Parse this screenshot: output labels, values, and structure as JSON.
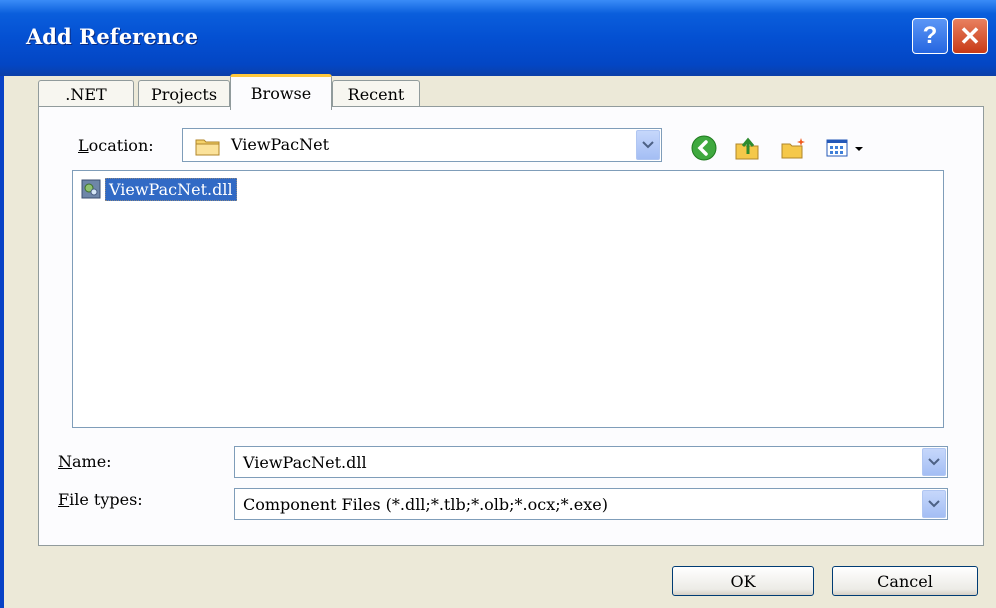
{
  "dialog": {
    "title": "Add Reference"
  },
  "titlebar_buttons": {
    "help": "?",
    "close": "✕"
  },
  "tabs": [
    {
      "label": ".NET"
    },
    {
      "label": "Projects"
    },
    {
      "label": "Browse"
    },
    {
      "label": "Recent"
    }
  ],
  "location": {
    "label_u": "L",
    "label_rest": "ocation:",
    "value": "ViewPacNet"
  },
  "files": [
    {
      "name": "ViewPacNet.dll"
    }
  ],
  "name_field": {
    "label_u": "N",
    "label_rest": "ame:",
    "value": "ViewPacNet.dll"
  },
  "filetypes_field": {
    "label_u": "F",
    "label_rest": "ile types:",
    "value": "Component Files (*.dll;*.tlb;*.olb;*.ocx;*.exe)"
  },
  "buttons": {
    "ok": "OK",
    "cancel": "Cancel"
  },
  "icons": [
    "folder-icon",
    "back-icon",
    "up-folder-icon",
    "new-folder-icon",
    "view-menu-icon",
    "dll-file-icon",
    "chevron-down-icon"
  ]
}
